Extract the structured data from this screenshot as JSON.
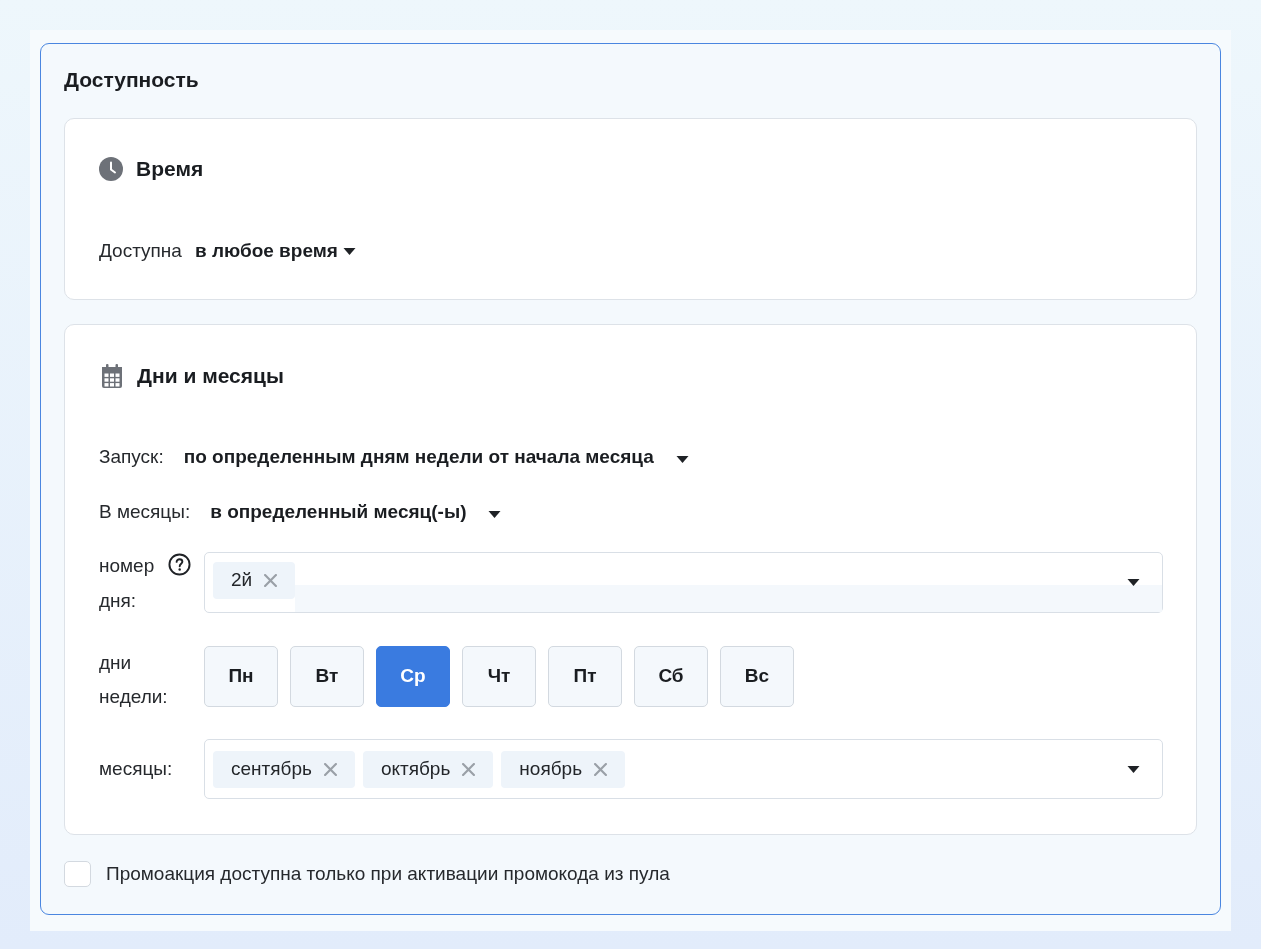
{
  "panel": {
    "title": "Доступность"
  },
  "time_section": {
    "title": "Время",
    "setting": {
      "label": "Доступна",
      "value": "в любое время"
    }
  },
  "days_section": {
    "title": "Дни и месяцы",
    "settings": [
      {
        "label": "Запуск:",
        "value": "по определенным дням недели от начала месяца"
      },
      {
        "label": "В месяцы:",
        "value": "в определенный месяц(-ы)"
      }
    ],
    "day_number": {
      "label": "номер дня:",
      "tags": [
        {
          "label": "2й"
        }
      ]
    },
    "weekdays": {
      "label": "дни недели:",
      "days": [
        {
          "label": "Пн",
          "selected": false
        },
        {
          "label": "Вт",
          "selected": false
        },
        {
          "label": "Ср",
          "selected": true
        },
        {
          "label": "Чт",
          "selected": false
        },
        {
          "label": "Пт",
          "selected": false
        },
        {
          "label": "Сб",
          "selected": false
        },
        {
          "label": "Вс",
          "selected": false
        }
      ]
    },
    "months": {
      "label": "месяцы:",
      "tags": [
        {
          "label": "сентябрь"
        },
        {
          "label": "октябрь"
        },
        {
          "label": "ноябрь"
        }
      ]
    }
  },
  "promo_checkbox": {
    "label": "Промоакция доступна только при активации промокода из пула",
    "checked": false
  }
}
